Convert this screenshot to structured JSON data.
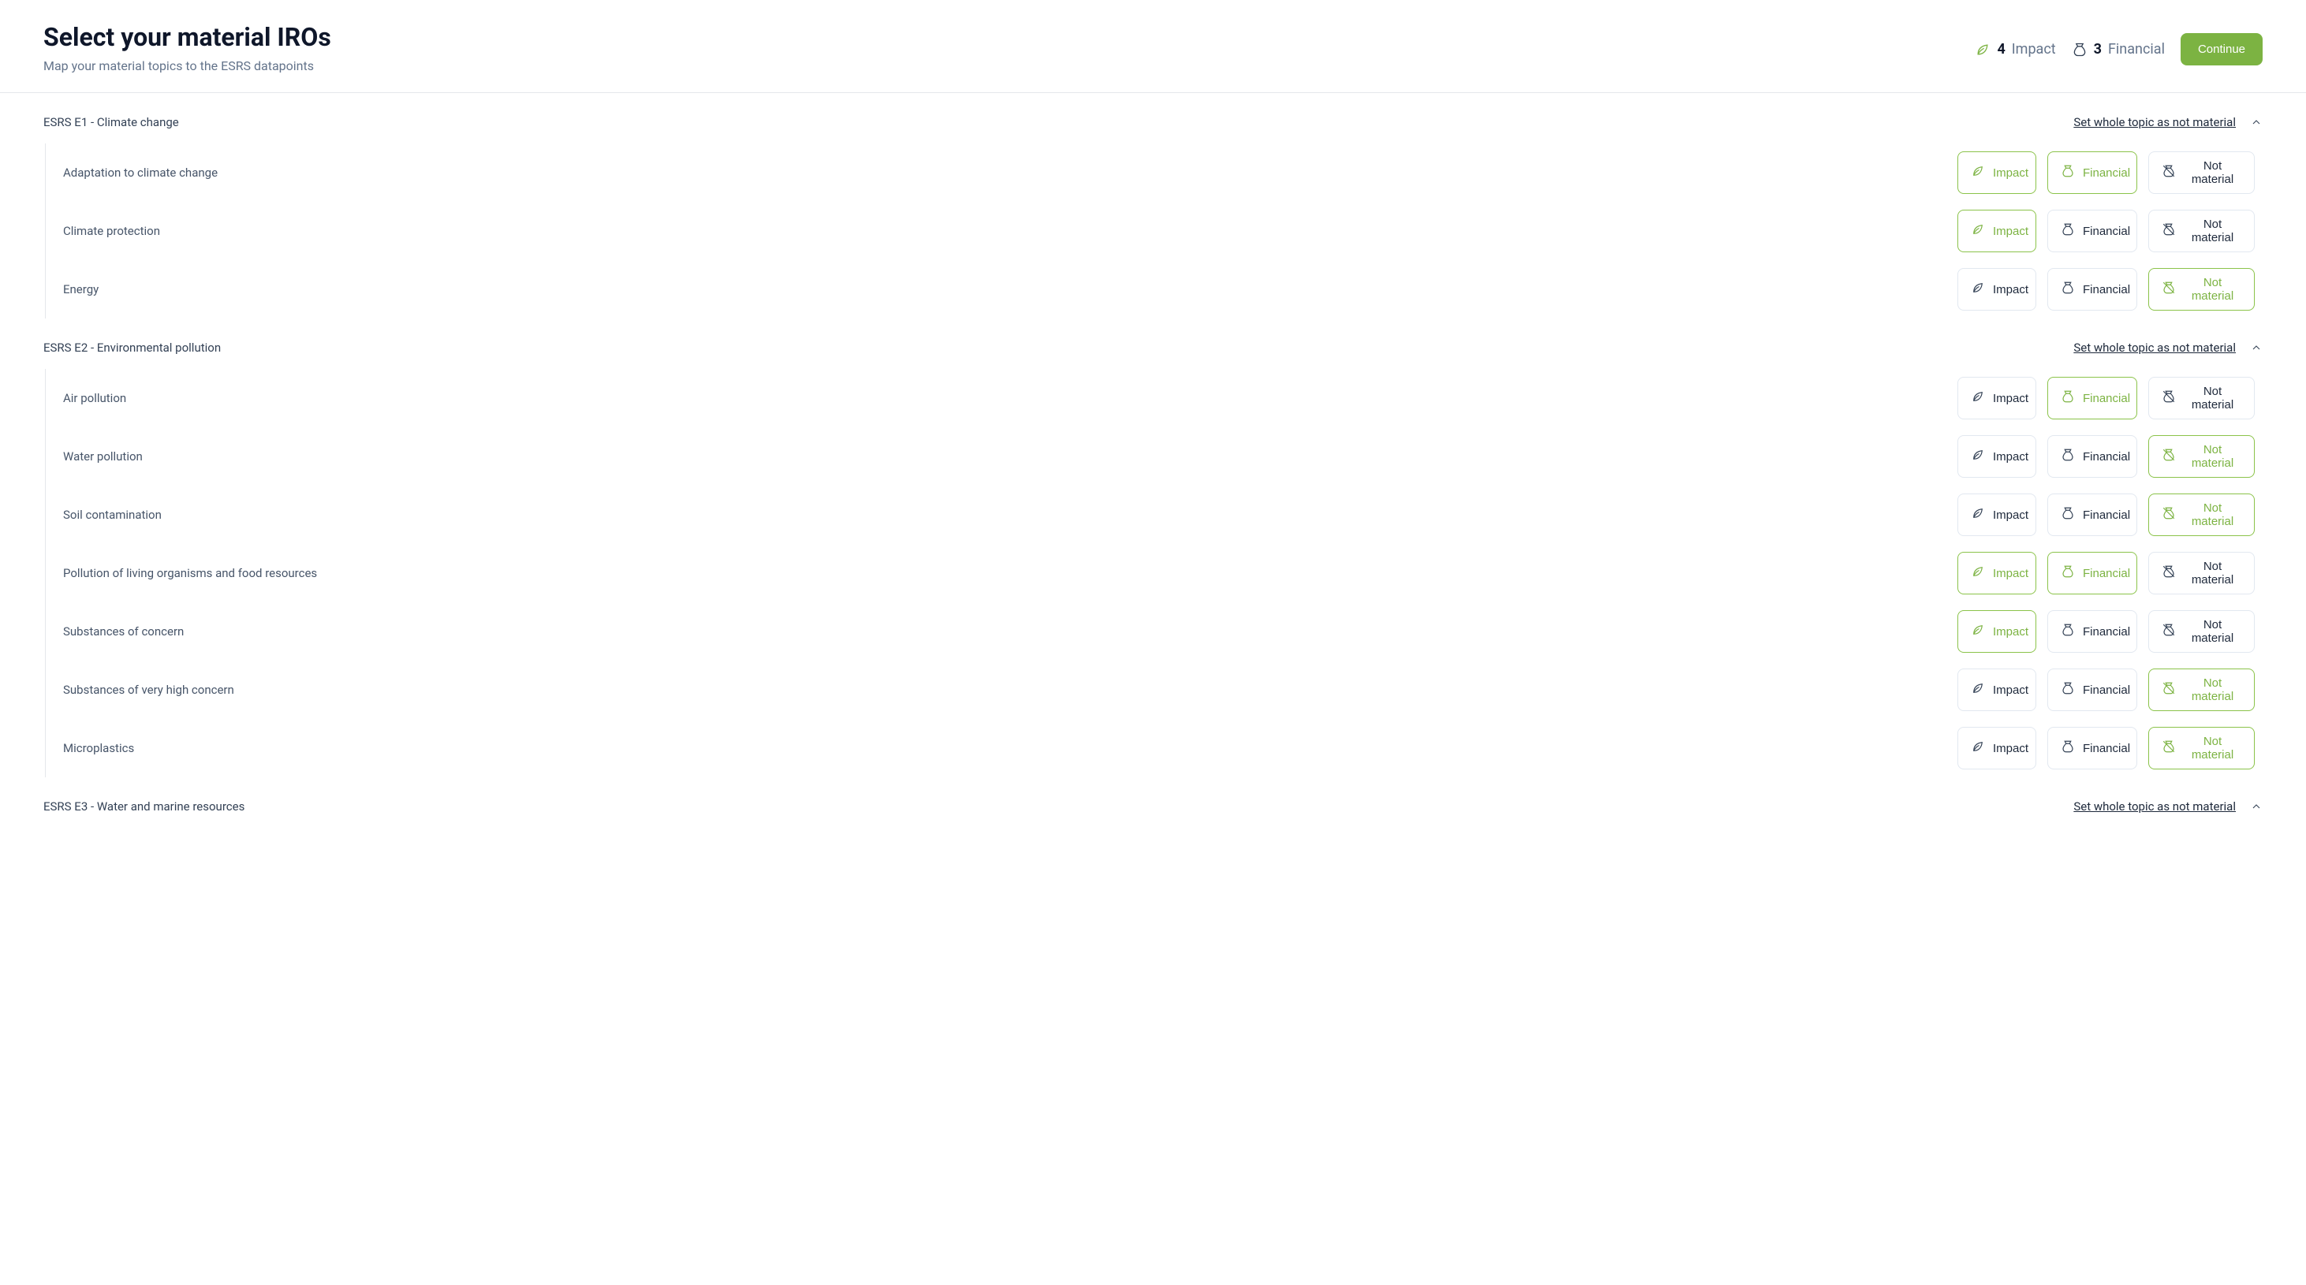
{
  "header": {
    "title": "Select your material IROs",
    "subtitle": "Map your material topics to the ESRS datapoints",
    "impact_count": "4",
    "impact_label": "Impact",
    "financial_count": "3",
    "financial_label": "Financial",
    "continue_label": "Continue"
  },
  "labels": {
    "impact": "Impact",
    "financial": "Financial",
    "not_material": "Not material",
    "set_not_material": "Set whole topic as not material"
  },
  "topics": [
    {
      "title": "ESRS E1 - Climate change",
      "subtopics": [
        {
          "label": "Adaptation to climate change",
          "impact": true,
          "financial": true,
          "not_material": false
        },
        {
          "label": "Climate protection",
          "impact": true,
          "financial": false,
          "not_material": false
        },
        {
          "label": "Energy",
          "impact": false,
          "financial": false,
          "not_material": true
        }
      ]
    },
    {
      "title": "ESRS E2 - Environmental pollution",
      "subtopics": [
        {
          "label": "Air pollution",
          "impact": false,
          "financial": true,
          "not_material": false
        },
        {
          "label": "Water pollution",
          "impact": false,
          "financial": false,
          "not_material": true
        },
        {
          "label": "Soil contamination",
          "impact": false,
          "financial": false,
          "not_material": true
        },
        {
          "label": "Pollution of living organisms and food resources",
          "impact": true,
          "financial": true,
          "not_material": false
        },
        {
          "label": "Substances of concern",
          "impact": true,
          "financial": false,
          "not_material": false
        },
        {
          "label": "Substances of very high concern",
          "impact": false,
          "financial": false,
          "not_material": true
        },
        {
          "label": "Microplastics",
          "impact": false,
          "financial": false,
          "not_material": true
        }
      ]
    },
    {
      "title": "ESRS E3 - Water and marine resources",
      "subtopics": []
    }
  ]
}
